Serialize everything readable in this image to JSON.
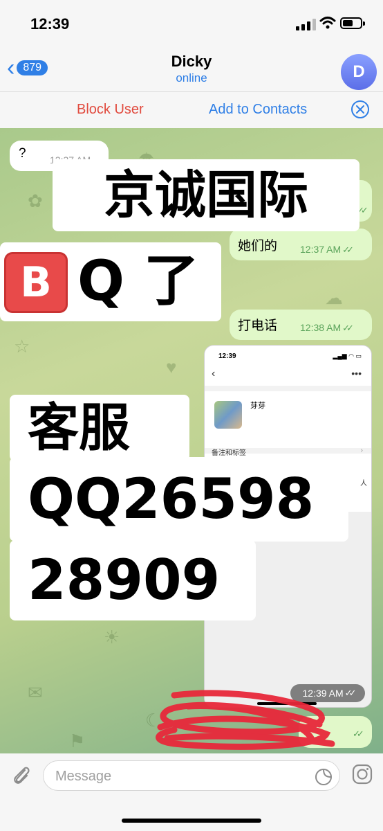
{
  "status_bar": {
    "time": "12:39"
  },
  "header": {
    "back_count": "879",
    "contact_name": "Dicky",
    "presence": "online",
    "avatar_initial": "D"
  },
  "action_bar": {
    "block_user": "Block User",
    "add_to_contacts": "Add to Contacts"
  },
  "messages": [
    {
      "text": "?",
      "time": "12:37 AM",
      "direction": "incoming"
    },
    {
      "text": "她们的",
      "time": "12:37 AM",
      "direction": "outgoing"
    },
    {
      "text": "打电话",
      "time": "12:38 AM",
      "direction": "outgoing"
    },
    {
      "text": "",
      "time": "12:39 AM",
      "direction": "outgoing"
    }
  ],
  "overlay_text": {
    "line1": "京诚国际",
    "b_badge": "B",
    "line2": "Q 了",
    "line3": "客服",
    "line4": "QQ26598",
    "line5": "28909"
  },
  "embedded_screenshot": {
    "time": "12:39",
    "name": "芽芽",
    "note_row": "备注和标签",
    "fragment": "人"
  },
  "input": {
    "placeholder": "Message"
  },
  "colors": {
    "accent": "#2f7fe6",
    "danger": "#e14b3f",
    "outgoing_bubble": "#e1f8c9",
    "scribble": "#e8283a"
  },
  "icons": [
    "back-chevron-icon",
    "close-circle-icon",
    "attach-icon",
    "sticker-icon",
    "camera-icon",
    "signal-icon",
    "wifi-icon",
    "battery-icon",
    "read-ticks-icon"
  ]
}
